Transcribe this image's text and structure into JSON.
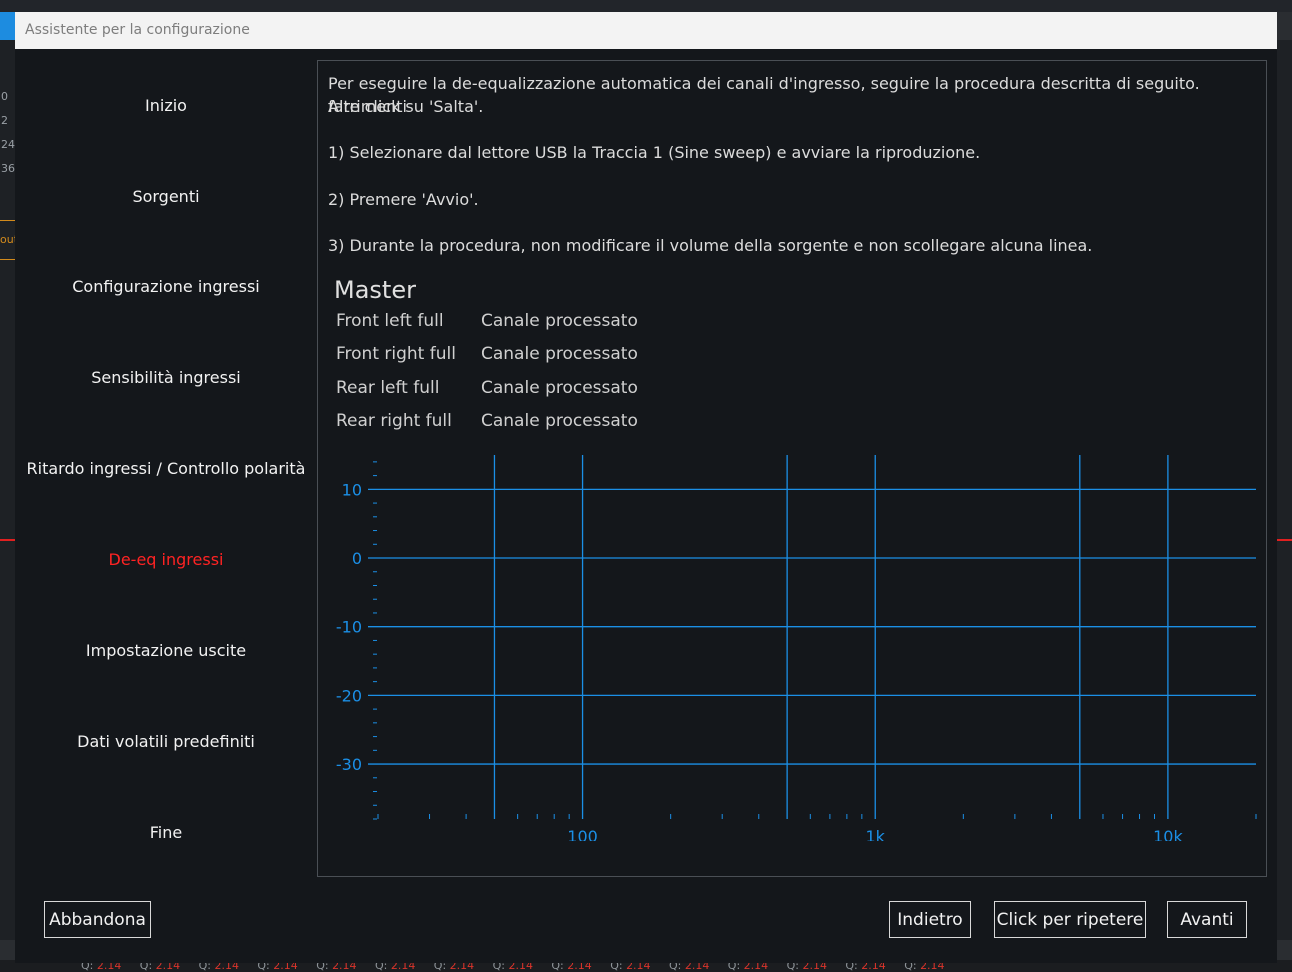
{
  "window_title": "Assistente per la configurazione",
  "nav": [
    {
      "label": "Inizio",
      "active": false
    },
    {
      "label": "Sorgenti",
      "active": false
    },
    {
      "label": "Configurazione ingressi",
      "active": false
    },
    {
      "label": "Sensibilità ingressi",
      "active": false
    },
    {
      "label": "Ritardo ingressi / Controllo polarità",
      "active": false
    },
    {
      "label": "De-eq ingressi",
      "active": true
    },
    {
      "label": "Impostazione uscite",
      "active": false
    },
    {
      "label": "Dati volatili predefiniti",
      "active": false
    },
    {
      "label": "Fine",
      "active": false
    }
  ],
  "instructions": {
    "intro_line1": "Per eseguire la de-equalizzazione automatica dei canali d'ingresso, seguire la procedura descritta di seguito. Altrimenti",
    "intro_line2": "fare click su 'Salta'.",
    "step1": "1) Selezionare dal lettore USB la Traccia 1 (Sine sweep) e avviare la riproduzione.",
    "step2": "2) Premere 'Avvio'.",
    "step3": "3) Durante la procedura, non modificare il volume della sorgente e non scollegare alcuna linea."
  },
  "master": {
    "title": "Master",
    "channels": [
      {
        "name": "Front left full",
        "status": "Canale processato"
      },
      {
        "name": "Front right full",
        "status": "Canale processato"
      },
      {
        "name": "Rear left full",
        "status": "Canale processato"
      },
      {
        "name": "Rear right full",
        "status": "Canale processato"
      }
    ]
  },
  "chart_data": {
    "type": "line",
    "title": "",
    "xlabel": "",
    "ylabel": "",
    "x_scale": "log",
    "xlim": [
      20,
      20000
    ],
    "ylim": [
      -38,
      15
    ],
    "x_ticks": [
      {
        "value": 100,
        "label": "100"
      },
      {
        "value": 1000,
        "label": "1k"
      },
      {
        "value": 10000,
        "label": "10k"
      }
    ],
    "y_ticks": [
      {
        "value": 10,
        "label": "10"
      },
      {
        "value": 0,
        "label": "0"
      },
      {
        "value": -10,
        "label": "-10"
      },
      {
        "value": -20,
        "label": "-20"
      },
      {
        "value": -30,
        "label": "-30"
      }
    ],
    "x_gridlines": [
      50,
      100,
      500,
      1000,
      5000,
      10000
    ],
    "y_gridlines": [
      10,
      0,
      -10,
      -20,
      -30
    ],
    "grid": true,
    "series": [],
    "color": "#1b8fe6"
  },
  "buttons": {
    "abandon": "Abbandona",
    "back": "Indietro",
    "repeat": "Click per ripetere",
    "next": "Avanti"
  },
  "background": {
    "left_ticks": [
      "0",
      "2",
      "24",
      "36"
    ],
    "left_orange_label": "out",
    "bottom_label": "Q:",
    "bottom_value": "2.14"
  }
}
